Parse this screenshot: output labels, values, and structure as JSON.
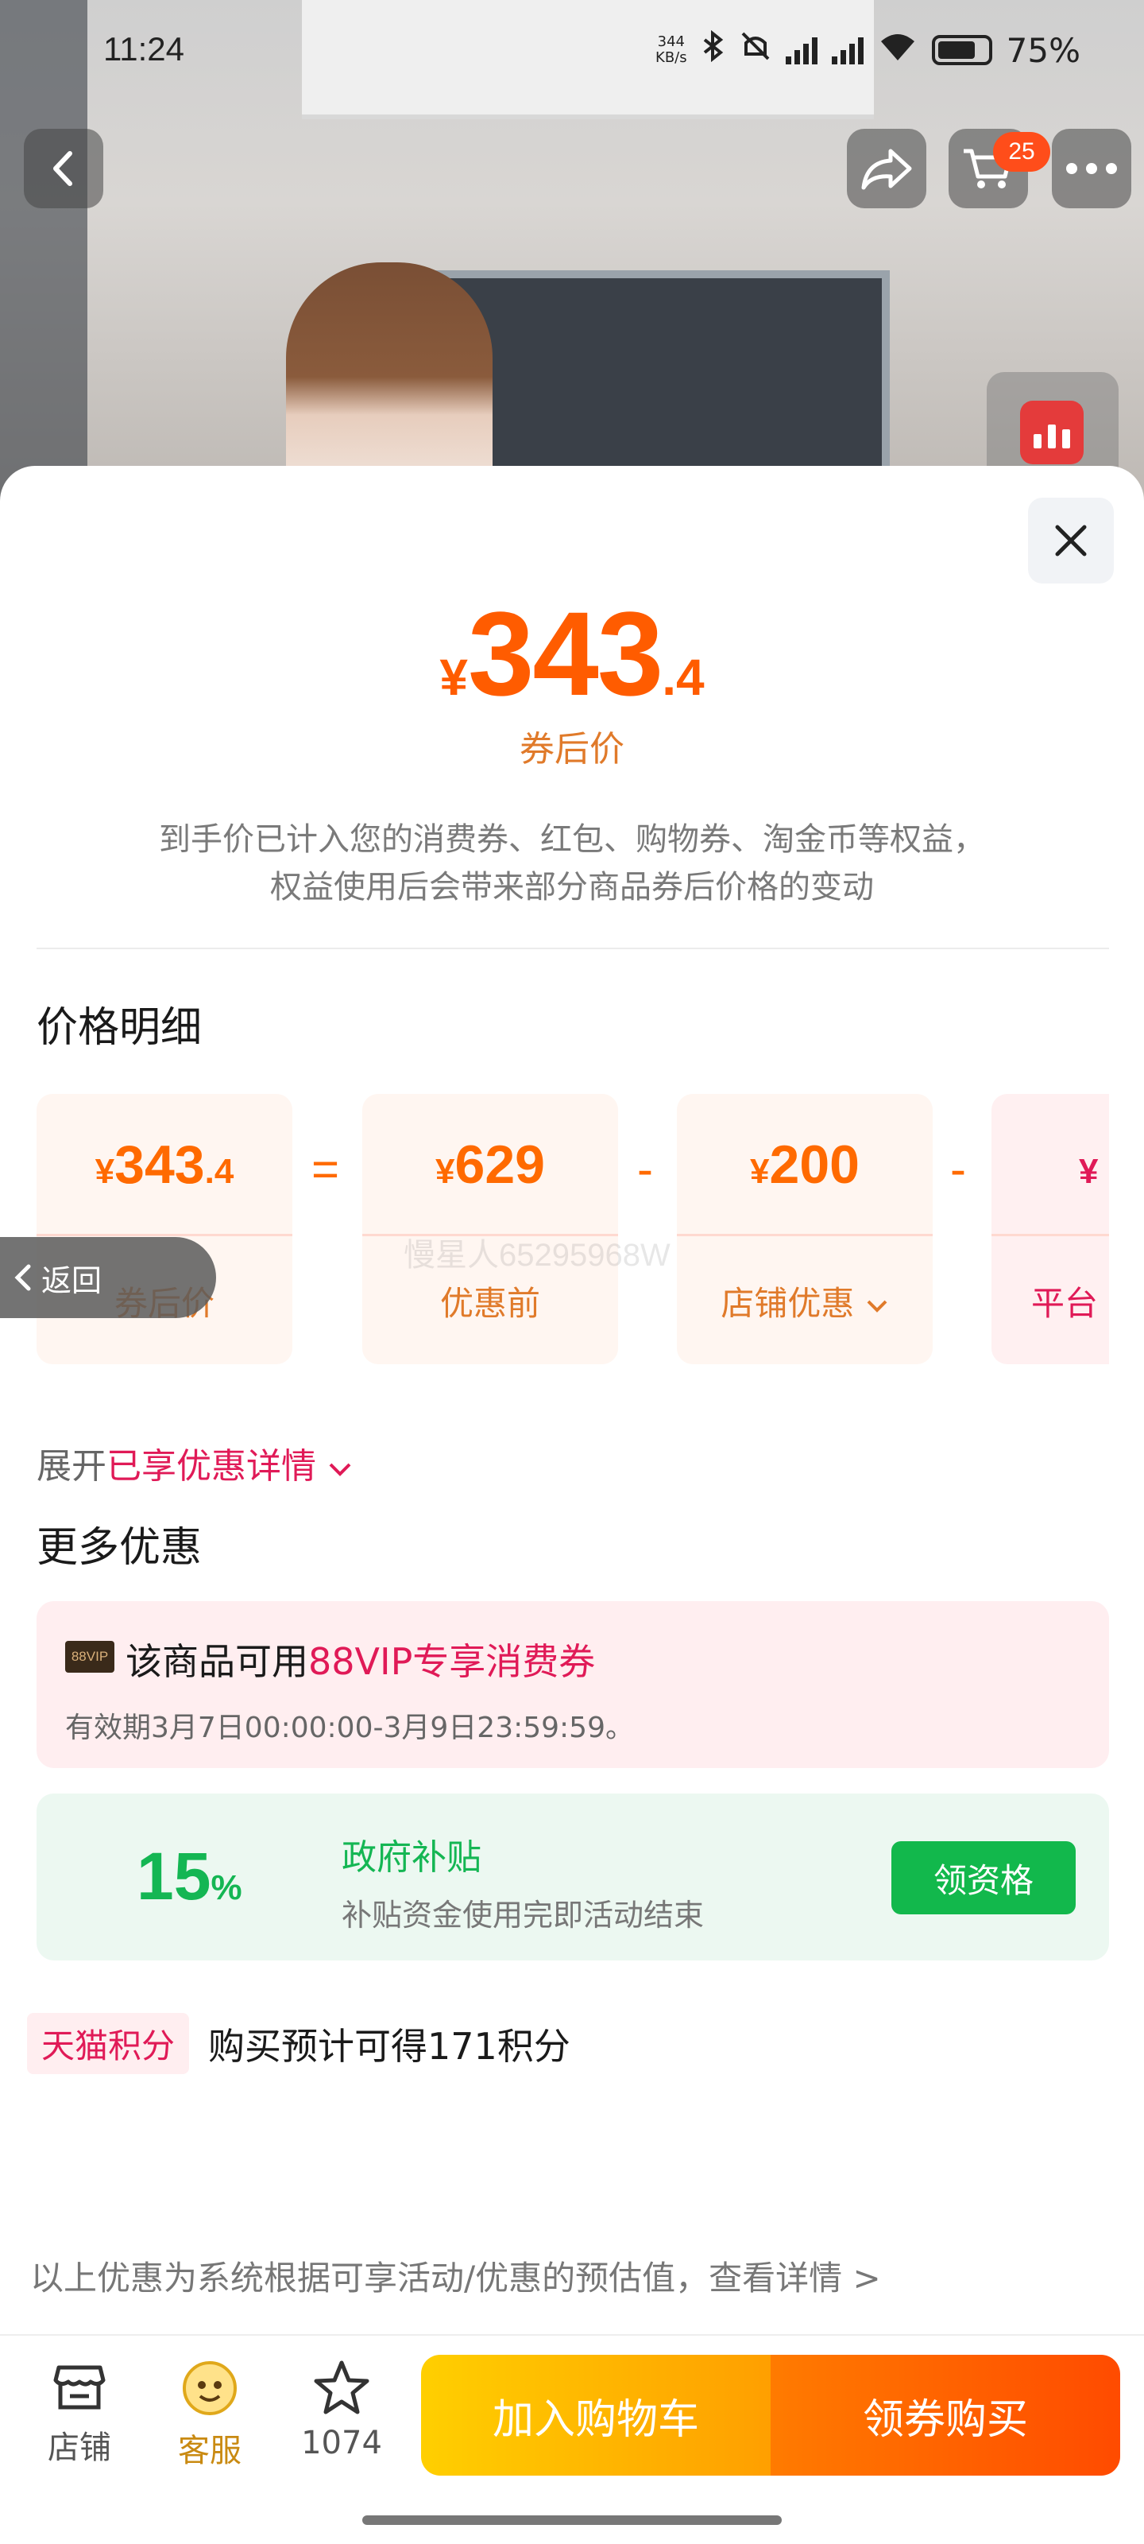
{
  "status_bar": {
    "time": "11:24",
    "net_speed": "344",
    "net_unit": "KB/s",
    "battery": "75%"
  },
  "header": {
    "cart_count": "25"
  },
  "price": {
    "currency": "¥",
    "integer": "343",
    "decimal": ".4",
    "caption": "券后价"
  },
  "note": {
    "line1": "到手价已计入您的消费券、红包、购物券、淘金币等权益，",
    "line2": "权益使用后会带来部分商品券后价格的变动"
  },
  "breakdown": {
    "title": "价格明细",
    "cards": [
      {
        "currency": "¥",
        "value": "343",
        "decimal": ".4",
        "label": "券后价"
      },
      {
        "currency": "¥",
        "value": "629",
        "decimal": "",
        "label": "优惠前"
      },
      {
        "currency": "¥",
        "value": "200",
        "decimal": "",
        "label": "店铺优惠"
      },
      {
        "currency": "¥",
        "value": "",
        "decimal": "",
        "label": "平台"
      }
    ],
    "ops": [
      "=",
      "-",
      "-"
    ],
    "watermark": "慢星人65295968W"
  },
  "expand": {
    "prefix": "展开",
    "highlight": "已享优惠详情"
  },
  "more": {
    "title": "更多优惠",
    "vip": {
      "tag": "88VIP",
      "text_prefix": "该商品可用",
      "text_highlight": "88VIP专享消费券",
      "validity": "有效期3月7日00:00:00-3月9日23:59:59。"
    },
    "subsidy": {
      "percent": "15",
      "percent_sign": "%",
      "title": "政府补贴",
      "subtitle": "补贴资金使用完即活动结束",
      "button": "领资格"
    }
  },
  "points": {
    "tag": "天猫积分",
    "text": "购买预计可得171积分"
  },
  "disclaimer": "以上优惠为系统根据可享活动/优惠的预估值，查看详情 >",
  "return_label": "返回",
  "bottom": {
    "shop_label": "店铺",
    "service_label": "客服",
    "fav_count": "1074",
    "cart_button": "加入购物车",
    "buy_button": "领券购买"
  },
  "colors": {
    "price_orange": "#ff5c00",
    "accent_pink": "#e01a57",
    "subsidy_green": "#14b653"
  }
}
